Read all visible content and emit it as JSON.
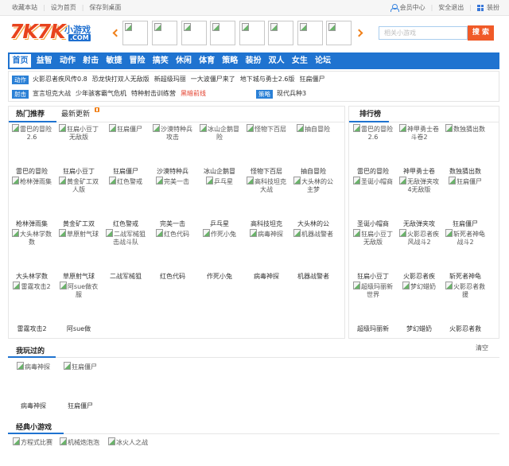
{
  "topbar": {
    "left_links": [
      "收藏本站",
      "设为首页",
      "保存到桌面"
    ],
    "member_center": "会员中心",
    "logout": "安全退出",
    "dress_up": "装扮",
    "icons": [
      "user-icon",
      "grid-icon"
    ]
  },
  "logo": {
    "main": "7K7K",
    "sub": "小游戏",
    "domain": ".COM"
  },
  "carousel": {
    "icons": [
      "chevron-left-icon",
      "chevron-right-icon",
      "broken-image-icon"
    ]
  },
  "search": {
    "placeholder": "相关小游戏",
    "button": "搜 索"
  },
  "nav": {
    "items": [
      "首页",
      "益智",
      "动作",
      "射击",
      "敏捷",
      "冒险",
      "搞笑",
      "休闲",
      "体育",
      "策略",
      "装扮",
      "双人",
      "女生",
      "论坛"
    ],
    "active": "首页"
  },
  "subnav": {
    "rows": [
      {
        "badge": "动作",
        "links": [
          "火影忍者疾风传0.8",
          "恐龙快打双人无敌版",
          "新超级玛丽",
          "一大波僵尸来了",
          "地下城与勇士2.6版",
          "狂扁僵尸"
        ]
      },
      {
        "badge": "射击",
        "links": [
          "宣言坦克大战",
          "少年骇客霸气危机",
          "特种射击训练营",
          "黑暗前线"
        ]
      },
      {
        "badge": "策略",
        "links": [
          "现代兵种3"
        ]
      }
    ]
  },
  "hot": {
    "tabs": [
      "热门推荐",
      "最新更新"
    ],
    "items": [
      {
        "alt": "雷巴的冒险 2.6",
        "title": "雷巴的冒险"
      },
      {
        "alt": "狂扁小豆丁无敌版",
        "title": "狂扁小豆丁"
      },
      {
        "alt": "狂扁僵尸",
        "title": "狂扁僵尸"
      },
      {
        "alt": "沙漠特种兵攻击",
        "title": "沙漠特种兵"
      },
      {
        "alt": "冰山企鹅冒险",
        "title": "冰山企鹅冒"
      },
      {
        "alt": "怪物下百层",
        "title": "怪物下百层"
      },
      {
        "alt": "抽自冒险",
        "title": "抽自冒险"
      },
      {
        "alt": "枪林弹雨集",
        "title": "枪林弹雨集"
      },
      {
        "alt": "黄金矿工双人版",
        "title": "黄金矿工双"
      },
      {
        "alt": "红色警戒",
        "title": "红色警戒"
      },
      {
        "alt": "完美一击",
        "title": "完美一击"
      },
      {
        "alt": "乒乓星",
        "title": "乒乓星"
      },
      {
        "alt": "高科技坦克大战",
        "title": "高科技坦克"
      },
      {
        "alt": "大头林的公主梦",
        "title": "大头林的公"
      },
      {
        "alt": "大头林学数数",
        "title": "大头林学数"
      },
      {
        "alt": "草原射气球",
        "title": "草原射气球"
      },
      {
        "alt": "二战军械狙击战斗队",
        "title": "二战军械狙"
      },
      {
        "alt": "红色代码",
        "title": "红色代码"
      },
      {
        "alt": "作死小兔",
        "title": "作死小兔"
      },
      {
        "alt": "病毒神探",
        "title": "病毒神探"
      },
      {
        "alt": "机器战警者",
        "title": "机器战警者"
      },
      {
        "alt": "雷霆攻击2",
        "title": "雷霆攻击2"
      },
      {
        "alt": "阿sue做衣服",
        "title": "阿sue做"
      }
    ]
  },
  "rank": {
    "title": "排行榜",
    "items": [
      {
        "alt": "雷巴的冒险 2.6",
        "title": "雷巴的冒险"
      },
      {
        "alt": "神甲勇士卷斗卷2",
        "title": "神甲勇士卷"
      },
      {
        "alt": "数独猜出数",
        "title": "数独猜出数"
      },
      {
        "alt": "圣诞小帽商",
        "title": "圣诞小帽商"
      },
      {
        "alt": "无敌弹夹攻4无敌版",
        "title": "无敌弹夹攻"
      },
      {
        "alt": "狂扁僵尸",
        "title": "狂扁僵尸"
      },
      {
        "alt": "狂扁小豆丁无敌版",
        "title": "狂扁小豆丁"
      },
      {
        "alt": "火影忍者疾风战斗2",
        "title": "火影忍者疾"
      },
      {
        "alt": "斩死者神龟战斗2",
        "title": "斩死者神龟"
      },
      {
        "alt": "超级玛丽新世界",
        "title": "超级玛丽新"
      },
      {
        "alt": "梦幻蜡奶",
        "title": "梦幻蜡奶"
      },
      {
        "alt": "火影忍者救援",
        "title": "火影忍者救"
      }
    ]
  },
  "played": {
    "title": "我玩过的",
    "clear": "清空",
    "items": [
      {
        "alt": "病毒神探",
        "title": "病毒神探"
      },
      {
        "alt": "狂扁僵尸",
        "title": "狂扁僵尸"
      }
    ]
  },
  "classic": {
    "title": "经典小游戏",
    "items": [
      "方程式比赛",
      "机械炮泡泡",
      "冰火人之战"
    ]
  },
  "colors": {
    "nav_blue": "#1f73d0",
    "search_button": "#f05a28",
    "arrow_orange": "#f08019",
    "highlight_red": "#e33e2b",
    "logo_red": "#e8431d"
  }
}
